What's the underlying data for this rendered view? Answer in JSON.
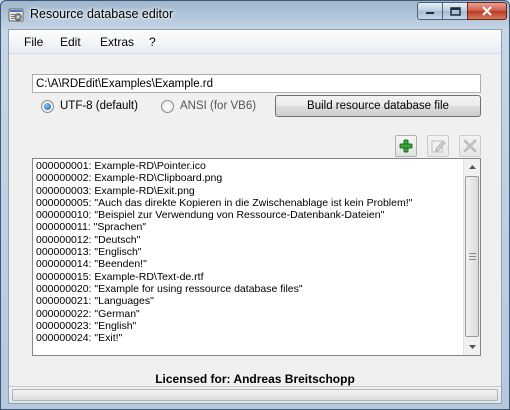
{
  "window": {
    "title": "Resource database editor",
    "icon": "app-gear-icon"
  },
  "menu": {
    "items": [
      "File",
      "Edit",
      "Extras",
      "?"
    ]
  },
  "path_input": {
    "value": "C:\\A\\RDEdit\\Examples\\Example.rd"
  },
  "encoding": {
    "options": [
      {
        "label": "UTF-8 (default)",
        "selected": true
      },
      {
        "label": "ANSI (for VB6)",
        "selected": false
      }
    ]
  },
  "build_button": {
    "label": "Build resource database file"
  },
  "toolbar": {
    "add_icon": "add-plus-icon",
    "edit_icon": "edit-icon",
    "delete_icon": "delete-x-icon"
  },
  "entries": [
    "000000001: Example-RD\\Pointer.ico",
    "000000002: Example-RD\\Clipboard.png",
    "000000003: Example-RD\\Exit.png",
    "000000005: \"Auch das direkte Kopieren in die Zwischenablage ist kein Problem!\"",
    "000000010: \"Beispiel zur Verwendung von Ressource-Datenbank-Dateien\"",
    "000000011: \"Sprachen\"",
    "000000012: \"Deutsch\"",
    "000000013: \"Englisch\"",
    "000000014: \"Beenden!\"",
    "000000015: Example-RD\\Text-de.rtf",
    "000000020: \"Example for using ressource database files\"",
    "000000021: \"Languages\"",
    "000000022: \"German\"",
    "000000023: \"English\"",
    "000000024: \"Exit!\""
  ],
  "license": {
    "text": "Licensed for: Andreas Breitschopp"
  },
  "status": {
    "progress": 0
  }
}
